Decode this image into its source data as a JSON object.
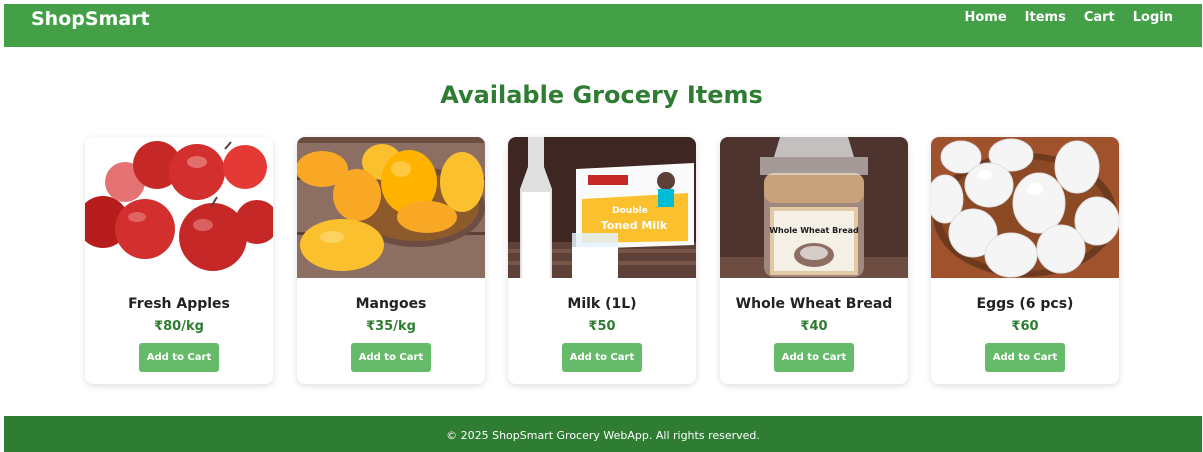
{
  "brand": "ShopSmart",
  "nav": [
    "Home",
    "Items",
    "Cart",
    "Login"
  ],
  "page_title": "Available Grocery Items",
  "products": [
    {
      "name": "Fresh Apples",
      "price": "₹80/kg",
      "button": "Add to Cart",
      "image": "apples-photo"
    },
    {
      "name": "Mangoes",
      "price": "₹35/kg",
      "button": "Add to Cart",
      "image": "mangoes-photo"
    },
    {
      "name": "Milk (1L)",
      "price": "₹50",
      "button": "Add to Cart",
      "image": "milk-photo"
    },
    {
      "name": "Whole Wheat Bread",
      "price": "₹40",
      "button": "Add to Cart",
      "image": "bread-photo"
    },
    {
      "name": "Eggs (6 pcs)",
      "price": "₹60",
      "button": "Add to Cart",
      "image": "eggs-photo"
    }
  ],
  "product_image_text": {
    "milk_brand": "Double",
    "milk_label": "Toned Milk",
    "bread_label": "Whole Wheat Bread"
  },
  "footer": "© 2025 ShopSmart Grocery WebApp. All rights reserved.",
  "colors": {
    "nav_bg": "#43a047",
    "title": "#2e7d32",
    "button": "#66bb6a",
    "footer_bg": "#2e7d32"
  }
}
